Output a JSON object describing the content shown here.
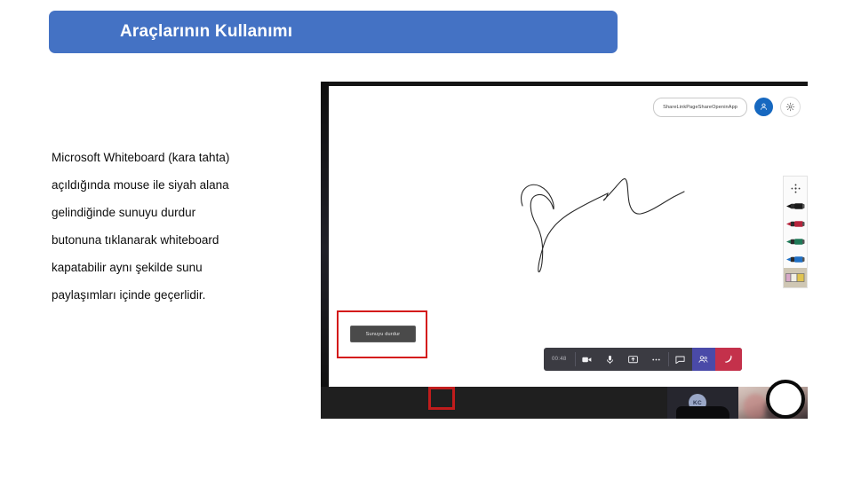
{
  "slide": {
    "title": "Araçlarının Kullanımı",
    "body_paragraphs": [
      "Microsoft Whiteboard (kara tahta)",
      "açıldığında mouse ile siyah alana",
      "gelindiğinde sunuyu durdur",
      "butonuna tıklanarak whiteboard",
      "kapatabilir aynı şekilde sunu",
      "paylaşımları içinde geçerlidir."
    ],
    "accent_color": "#4472c4"
  },
  "screenshot": {
    "whiteboard": {
      "share_pill_label": "ShareLinkPageShareOpeninApp",
      "account_avatar_icon": "person-icon",
      "settings_icon": "gear-icon",
      "ink_description": "freehand-ink-stroke"
    },
    "pen_toolbar": {
      "tools": [
        {
          "name": "pen-settings",
          "icon": "pen-settings-icon",
          "color": "#3a3a3a"
        },
        {
          "name": "pen-black",
          "icon": "pen-icon",
          "color": "#1b1b1b"
        },
        {
          "name": "pen-red",
          "icon": "pen-icon",
          "color": "#b5243c"
        },
        {
          "name": "pen-green",
          "icon": "pen-icon",
          "color": "#1f7a58"
        },
        {
          "name": "pen-blue",
          "icon": "pen-icon",
          "color": "#1f6fc4"
        },
        {
          "name": "eraser",
          "icon": "eraser-icon",
          "color": "#d9c89a"
        }
      ]
    },
    "stop_presenting": {
      "button_label": "Sunuyu durdur",
      "highlight_color": "#d41a1a"
    },
    "call_bar": {
      "timer": "00:48",
      "controls": [
        {
          "name": "camera-toggle",
          "icon": "camera-icon"
        },
        {
          "name": "microphone-toggle",
          "icon": "microphone-icon"
        },
        {
          "name": "share-screen",
          "icon": "share-screen-icon"
        },
        {
          "name": "more-options",
          "icon": "ellipsis-icon"
        },
        {
          "name": "chat",
          "icon": "chat-icon"
        },
        {
          "name": "participants",
          "icon": "people-icon"
        },
        {
          "name": "hang-up",
          "icon": "hangup-icon"
        }
      ],
      "hangup_color": "#c4314b",
      "active_color": "#4a4aa8"
    },
    "video_tiles": {
      "participant_initials": "KC"
    },
    "annotations": {
      "red_box_color": "#c01c1c",
      "cursor_ring": "cursor-highlight-ring"
    }
  }
}
